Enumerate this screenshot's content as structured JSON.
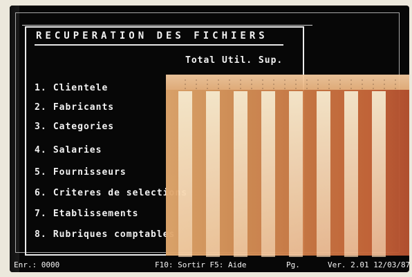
{
  "menu": {
    "title": "RECUPERATION DES FICHIERS",
    "columns": "Total  Util.  Sup.",
    "items": [
      {
        "num": "1.",
        "label": "Clientele"
      },
      {
        "num": "2.",
        "label": "Fabricants"
      },
      {
        "num": "3.",
        "label": "Categories"
      },
      {
        "num": "4.",
        "label": "Salaries"
      },
      {
        "num": "5.",
        "label": "Fournisseurs"
      },
      {
        "num": "6.",
        "label": "Criteres de selections"
      },
      {
        "num": "7.",
        "label": "Etablissements"
      },
      {
        "num": "8.",
        "label": "Rubriques comptables"
      }
    ]
  },
  "status": {
    "left": "Enr.: 0000",
    "middle": "F10: Sortir  F5: Aide",
    "page": "Pg.",
    "right": "Ver. 2.01 12/03/87"
  },
  "colors": {
    "screen": "#070707",
    "text": "#f2f2f2",
    "overlay": "#d69158"
  }
}
